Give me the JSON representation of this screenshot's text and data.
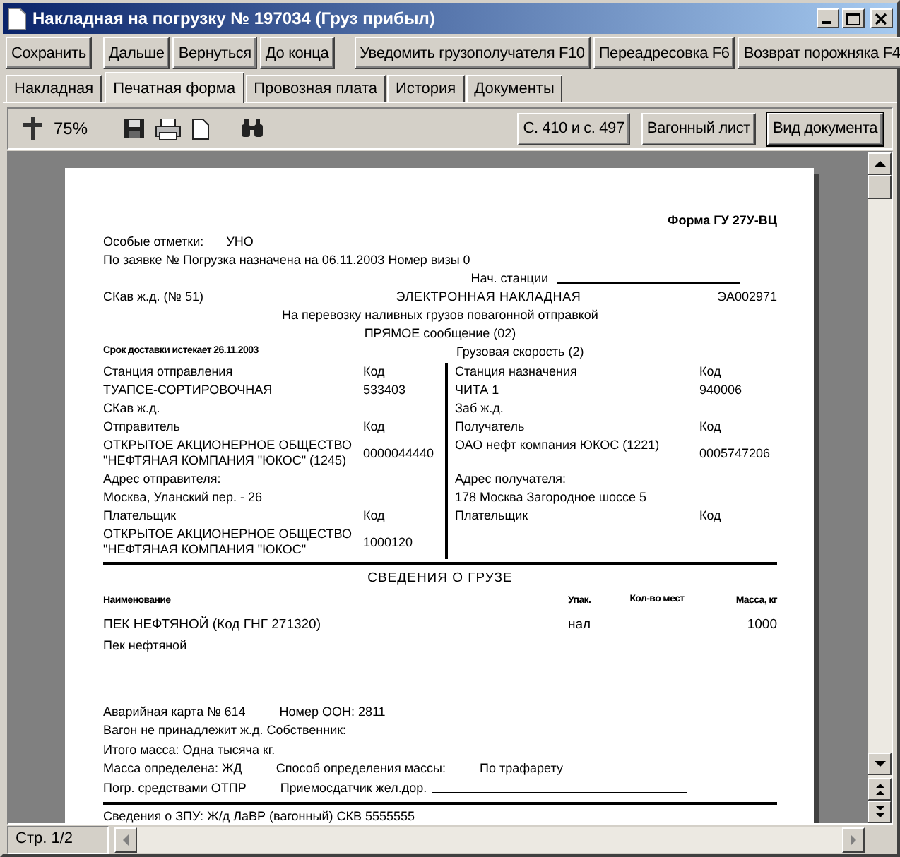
{
  "window": {
    "title": "Накладная на погрузку № 197034 (Груз прибыл)"
  },
  "action_groups": [
    [
      "Сохранить"
    ],
    [
      "Дальше",
      "Вернуться",
      "До конца"
    ],
    [
      "Уведомить грузополучателя F10",
      "Переадресовка F6",
      "Возврат порожняка F4"
    ]
  ],
  "tabs": [
    {
      "label": "Накладная",
      "selected": false
    },
    {
      "label": "Печатная форма",
      "selected": true
    },
    {
      "label": "Провозная плата",
      "selected": false
    },
    {
      "label": "История",
      "selected": false
    },
    {
      "label": "Документы",
      "selected": false
    }
  ],
  "viewer_toolbar": {
    "zoom": "75%",
    "buttons": [
      {
        "label": "С. 410 и с. 497",
        "focused": false
      },
      {
        "label": "Вагонный лист",
        "focused": false
      },
      {
        "label": "Вид документа",
        "focused": true
      }
    ]
  },
  "document": {
    "form_name": "Форма ГУ 27У-ВЦ",
    "special_marks": {
      "label": "Особые отметки:",
      "value": "УНО"
    },
    "request_line": "По заявке №  Погрузка назначена на 06.11.2003    Номер визы 0",
    "start_station_label": "Нач. станции",
    "railway": "СКав ж.д.  (№ 51)",
    "title": "ЭЛЕКТРОННАЯ НАКЛАДНАЯ",
    "number": "ЭА002971",
    "subtitle": "На перевозку наливных грузов повагонной отправкой",
    "message": "ПРЯМОЕ  сообщение (02)",
    "deadline": "Срок доставки истекает 26.11.2003",
    "speed": "Грузовая скорость (2)",
    "parties": [
      {
        "left": "Станция отправления",
        "left_code": "Код",
        "right": "Станция назначения",
        "right_code": "Код"
      },
      {
        "left": "ТУАПСЕ-СОРТИРОВОЧНАЯ",
        "left_code": "533403",
        "right": "ЧИТА 1",
        "right_code": "940006"
      },
      {
        "left": "СКав ж.д.",
        "right": "Заб ж.д."
      },
      {
        "left": "Отправитель",
        "left_code": "Код",
        "right": "Получатель",
        "right_code": "Код"
      },
      {
        "left": "ОТКРЫТОЕ АКЦИОНЕРНОЕ ОБЩЕСТВО \"НЕФТЯНАЯ КОМПАНИЯ \"ЮКОС\" (1245)",
        "left_code": "0000044440",
        "right": "ОАО нефт компания ЮКОС (1221)",
        "right_code": "0005747206"
      },
      {
        "left": "Адрес отправителя:",
        "right": "Адрес получателя:"
      },
      {
        "left": "Москва, Уланский пер. - 26",
        "right": "178 Москва Загородное шоссе 5"
      },
      {
        "left": "Плательщик",
        "left_code": "Код",
        "right": "Плательщик",
        "right_code": "Код"
      },
      {
        "left": "ОТКРЫТОЕ АКЦИОНЕРНОЕ ОБЩЕСТВО \"НЕФТЯНАЯ КОМПАНИЯ \"ЮКОС\"",
        "left_code": "1000120"
      }
    ],
    "cargo": {
      "heading": "СВЕДЕНИЯ О ГРУЗЕ",
      "columns": [
        "Наименование",
        "Упак.",
        "Кол-во мест",
        "Масса, кг"
      ],
      "rows": [
        {
          "name": "ПЕК НЕФТЯНОЙ (Код ГНГ 271320)",
          "subname": "Пек нефтяной",
          "packaging": "нал",
          "mass": "1000"
        }
      ]
    },
    "footer_lines": [
      {
        "items": [
          "Аварийная карта №  614",
          "Номер ООН:  2811"
        ],
        "signature_line": false,
        "rule_above": false
      },
      {
        "items": [
          "Вагон не принадлежит ж.д. Собственник:"
        ],
        "signature_line": false,
        "rule_above": false
      },
      {
        "items": [
          "Итого масса:   Одна тысяча кг."
        ],
        "signature_line": false,
        "rule_above": false
      },
      {
        "items": [
          "Масса определена:   ЖД",
          "Способ определения массы:",
          "По трафарету"
        ],
        "signature_line": false,
        "rule_above": false
      },
      {
        "items": [
          "Погр. средствами  ОТПР",
          "Приемосдатчик жел.дор."
        ],
        "signature_line": true,
        "rule_above": false
      },
      {
        "items": [
          "Сведения о ЗПУ:  Ж/д ЛаВР (вагонный) СКВ 5555555"
        ],
        "signature_line": false,
        "rule_above": true
      }
    ]
  },
  "status_bar": {
    "page": "Стр. 1/2"
  }
}
